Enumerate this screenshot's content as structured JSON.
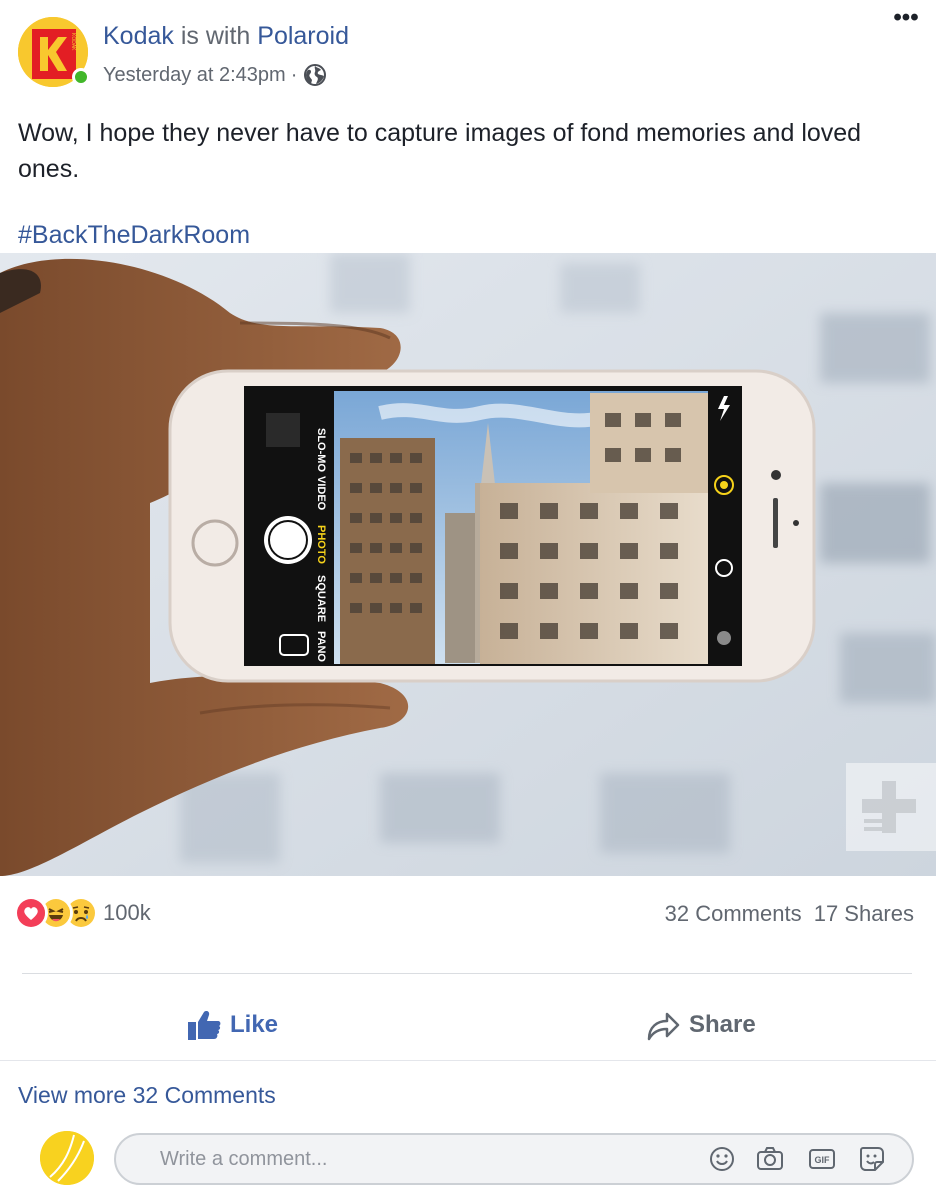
{
  "post": {
    "author": "Kodak",
    "with_text": "is with",
    "tagged": "Polaroid",
    "timestamp": "Yesterday at 2:43pm",
    "separator": "·",
    "audience_icon": "globe-icon",
    "more_icon": "more-options-icon",
    "more_label": "•••",
    "text": "Wow, I hope they never have to capture images of fond memories and loved ones.",
    "hashtag": "#BackTheDarkRoom",
    "avatar_logo_text": "KODAK"
  },
  "stats": {
    "reactions": [
      "love-reaction-icon",
      "haha-reaction-icon",
      "sad-reaction-icon"
    ],
    "reaction_count": "100k",
    "comments": "32 Comments",
    "shares": "17 Shares"
  },
  "actions": {
    "like": "Like",
    "share": "Share"
  },
  "comments": {
    "view_more": "View more 32 Comments",
    "placeholder": "Write a comment...",
    "icons": [
      "emoji-icon",
      "camera-icon",
      "gif-icon",
      "sticker-icon"
    ],
    "gif_label": "GIF"
  },
  "photo": {
    "camera_modes": [
      "SLO-MO",
      "VIDEO",
      "PHOTO",
      "SQUARE",
      "PANO"
    ],
    "active_mode": "PHOTO"
  },
  "colors": {
    "link": "#365899",
    "like_blue": "#4267b2",
    "online": "#42b72a",
    "kodak_red": "#e31e24",
    "kodak_yellow": "#f8c82e"
  }
}
